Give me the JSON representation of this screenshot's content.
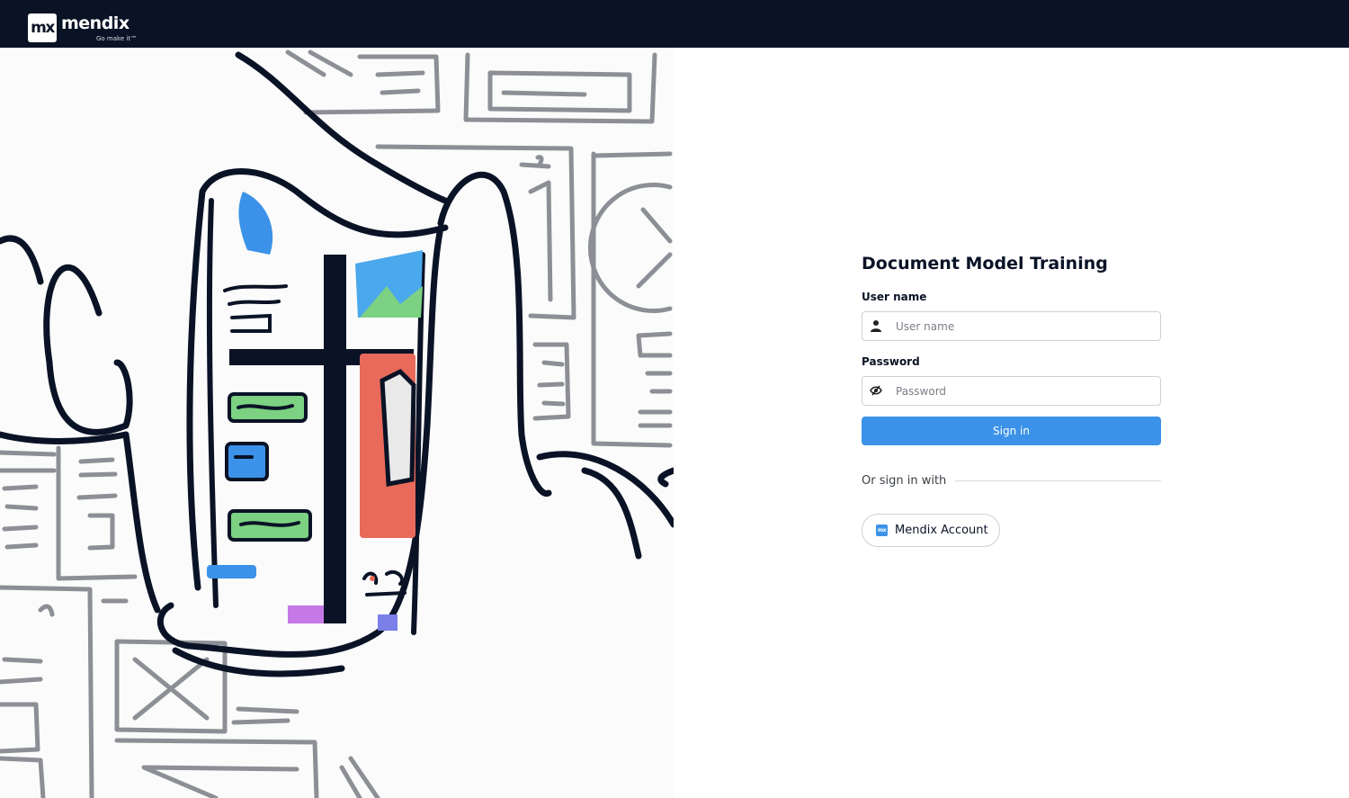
{
  "header": {
    "logo_mark": "mx",
    "logo_word": "mendix",
    "logo_tagline": "Go make it™"
  },
  "login": {
    "title": "Document Model Training",
    "username_label": "User name",
    "username_placeholder": "User name",
    "username_icon": "user-icon",
    "password_label": "Password",
    "password_placeholder": "Password",
    "password_icon": "eye-slash-icon",
    "signin_label": "Sign in",
    "or_signin_with": "Or sign in with",
    "sso_icon": "mendix-logo-icon",
    "sso_label": "Mendix Account"
  },
  "colors": {
    "topbar": "#0a1326",
    "primary": "#3b92e8",
    "illustration_stroke": "#0a1326",
    "illustration_gray": "#8c8f95"
  }
}
